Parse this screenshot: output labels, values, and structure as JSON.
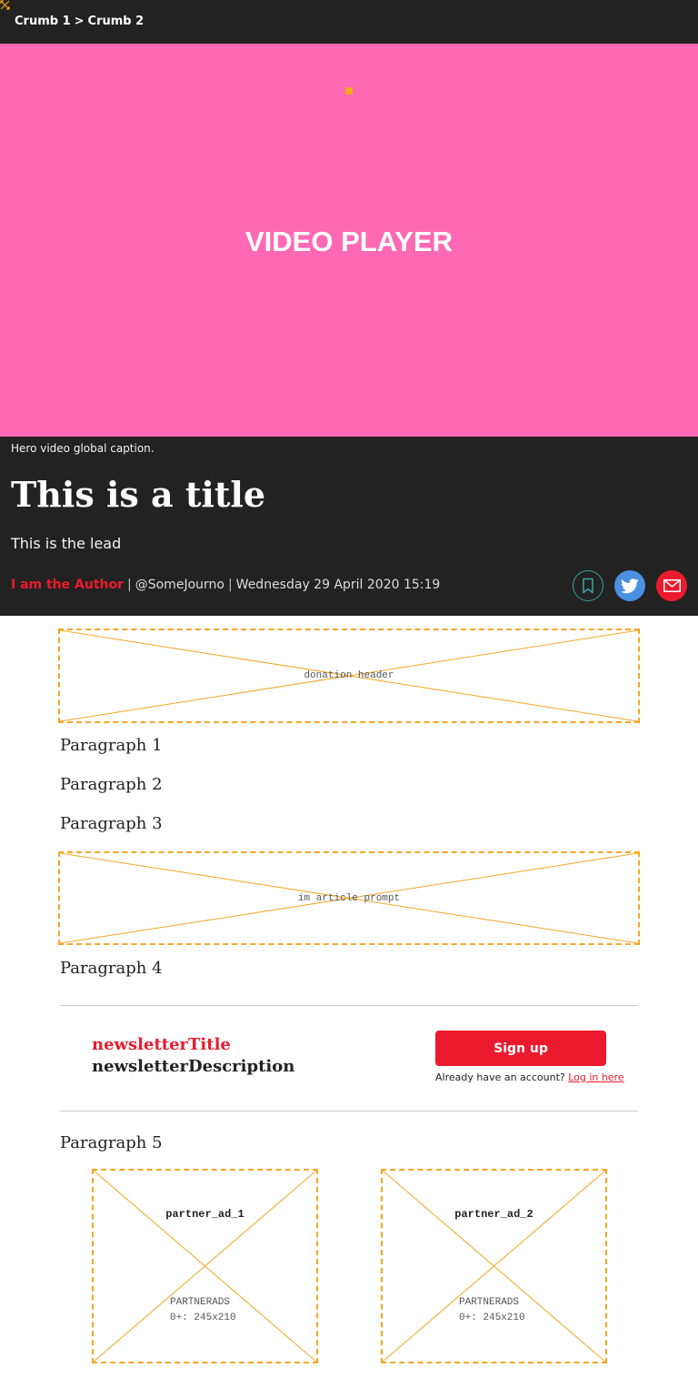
{
  "breadcrumb": {
    "items": [
      "Crumb 1",
      "Crumb 2"
    ],
    "separator": ">"
  },
  "video": {
    "label": "VIDEO PLAYER",
    "background": "#ff69b4"
  },
  "hero": {
    "caption": "Hero video global caption.",
    "title": "This is a title",
    "lead": "This is the lead",
    "author": "I am the Author",
    "handle": "@SomeJourno",
    "date": "Wednesday 29 April 2020 15:19"
  },
  "share": {
    "bookmark_icon": "bookmark-icon",
    "twitter_icon": "twitter-icon",
    "email_icon": "email-icon"
  },
  "placeholders": {
    "donation_header": "donation header",
    "article_prompt": "im article prompt"
  },
  "paragraphs": [
    "Paragraph 1",
    "Paragraph 2",
    "Paragraph 3",
    "Paragraph 4",
    "Paragraph 5"
  ],
  "newsletter": {
    "title": "newsletterTitle",
    "description": "newsletterDescription",
    "signup_label": "Sign up",
    "account_prompt": "Already have an account?",
    "login_link": "Log in here"
  },
  "ads": [
    {
      "name": "partner_ad_1",
      "type": "PARTNERADS",
      "size": "0+: 245x210"
    },
    {
      "name": "partner_ad_2",
      "type": "PARTNERADS",
      "size": "0+: 245x210"
    }
  ],
  "colors": {
    "accent": "#ec1a2e",
    "placeholder_border": "#f5a623",
    "dark_bg": "#222222",
    "twitter": "#4a90e2"
  }
}
